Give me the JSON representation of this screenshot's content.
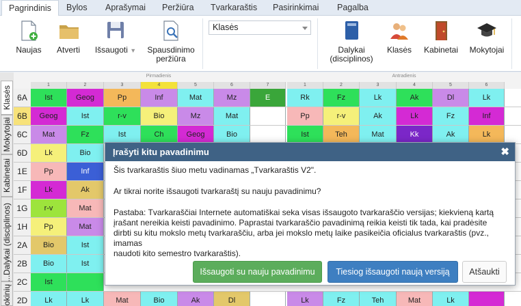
{
  "menu": [
    "Pagrindinis",
    "Bylos",
    "Aprašymai",
    "Peržiūra",
    "Tvarkaraštis",
    "Pasirinkimai",
    "Pagalba"
  ],
  "ribbon": {
    "new": "Naujas",
    "open": "Atverti",
    "save": "Išsaugoti",
    "preview_line1": "Spausdinimo",
    "preview_line2": "peržiūra",
    "combo_value": "Klasės",
    "subjects_line1": "Dalykai",
    "subjects_line2": "(disciplinos)",
    "classes": "Klasės",
    "rooms": "Kabinetai",
    "teachers": "Mokytojai"
  },
  "sidetabs": [
    "Klasės",
    "Mokytojai",
    "Kabinetai",
    "Dalykai (disciplinos)",
    "Mokinių ..."
  ],
  "days": {
    "day1": "Pirmadienis",
    "day2": "Antradienis"
  },
  "colnums": [
    "1",
    "2",
    "3",
    "4",
    "5",
    "6",
    "7",
    "1",
    "2",
    "3",
    "4",
    "5",
    "6"
  ],
  "rows": [
    {
      "label": "6A",
      "cells": [
        "Ist",
        "Geog",
        "Pp",
        "Inf",
        "Mat",
        "Mz",
        "E",
        "Rk",
        "Fz",
        "Lk",
        "Ak",
        "Dl",
        "Lk"
      ]
    },
    {
      "label": "6B",
      "cells": [
        "Geog",
        "Ist",
        "r-v",
        "Bio",
        "Mz",
        "Mat",
        "",
        "Pp",
        "r-v",
        "Ak",
        "Lk",
        "Fz",
        "Inf"
      ]
    },
    {
      "label": "6C",
      "cells": [
        "Mat",
        "Fz",
        "Ist",
        "Ch",
        "Geog",
        "Bio",
        "",
        "Ist",
        "Teh",
        "Mat",
        "Kk",
        "Ak",
        "Lk"
      ]
    },
    {
      "label": "6D",
      "cells": [
        "Lk",
        "Bio"
      ]
    },
    {
      "label": "1E",
      "cells": [
        "Pp",
        "Inf"
      ]
    },
    {
      "label": "1F",
      "cells": [
        "Lk",
        "Ak"
      ]
    },
    {
      "label": "1G",
      "cells": [
        "r-v",
        "Mat"
      ]
    },
    {
      "label": "1H",
      "cells": [
        "Pp",
        "Mat"
      ]
    },
    {
      "label": "2A",
      "cells": [
        "Bio",
        "Ist"
      ]
    },
    {
      "label": "2B",
      "cells": [
        "Bio",
        "Ist"
      ]
    },
    {
      "label": "2C",
      "cells": [
        "Ist",
        ""
      ]
    },
    {
      "label": "2D",
      "cells": [
        "Lk",
        "Lk",
        "Mat",
        "Bio",
        "Ak",
        "Dl",
        "",
        "Lk",
        "Fz",
        "Teh",
        "Mat",
        "Lk",
        ""
      ]
    }
  ],
  "colors": {
    "green": "#2ee05a",
    "magenta": "#d42ad4",
    "orange": "#f4b85a",
    "cyan": "#7ff0f0",
    "purple": "#c98ae8",
    "darkgreen": "#3aa63a",
    "yellow": "#f5f07a",
    "pink": "#f7b8b8",
    "blue": "#3b5fd6",
    "khaki": "#e3c86a",
    "violet": "#7b27c8",
    "lime": "#9de43c",
    "dialog_header": "#3f6285",
    "button_green": "#5cad5c",
    "button_blue": "#3e7fc1"
  },
  "dialog": {
    "title": "Įrašyti kitu pavadinimu",
    "line1": "Šis tvarkaraštis šiuo metu vadinamas „Tvarkaraštis V2\".",
    "line2": "Ar tikrai norite išsaugoti tvarkaraštį su nauju pavadinimu?",
    "note_l1": "Pastaba: Tvarkaraščiai Internete automatiškai seka visas išsaugoto tvarkaraščio versijas;  kiekvieną kartą",
    "note_l2": "įrašant nereikia keisti pavadinimo. Paprastai tvarkaraščio pavadinimą reikia keisti tik tada, kai pradėsite",
    "note_l3": "dirbti su kitu mokslo metų tvarkaraščiu, arba jei mokslo metų laike  pasikeičia oficialus tvarkaraštis (pvz., imamas",
    "note_l4": "naudoti kito semestro tvarkaraštis).",
    "btn_save_new": "Išsaugoti su nauju pavadinimu",
    "btn_save_version": "Tiesiog išsaugoti naują versiją",
    "btn_cancel": "Atšaukti"
  }
}
